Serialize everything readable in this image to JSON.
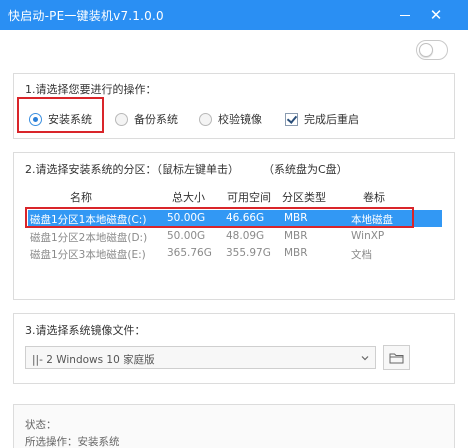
{
  "window": {
    "title": "快启动-PE一键装机v7.1.0.0",
    "minimize_icon": "minimize-icon",
    "close_icon": "close-icon",
    "accent": "#2a8ff3"
  },
  "toggle": {
    "state": "off"
  },
  "operation": {
    "label": "1.请选择您要进行的操作：",
    "options": [
      {
        "label": "安装系统",
        "selected": true
      },
      {
        "label": "备份系统",
        "selected": false
      },
      {
        "label": "校验镜像",
        "selected": false
      }
    ],
    "checkbox": {
      "label": "完成后重启",
      "checked": true
    }
  },
  "partition": {
    "label": "2.请选择安装系统的分区：（鼠标左键单击）",
    "hint": "（系统盘为C盘）",
    "columns": [
      "名称",
      "总大小",
      "可用空间",
      "分区类型",
      "卷标"
    ],
    "rows": [
      {
        "name": "磁盘1分区1本地磁盘(C:)",
        "total": "50.00G",
        "free": "46.66G",
        "type": "MBR",
        "label": "本地磁盘",
        "selected": true
      },
      {
        "name": "磁盘1分区2本地磁盘(D:)",
        "total": "50.00G",
        "free": "48.09G",
        "type": "MBR",
        "label": "WinXP",
        "selected": false
      },
      {
        "name": "磁盘1分区3本地磁盘(E:)",
        "total": "365.76G",
        "free": "355.97G",
        "type": "MBR",
        "label": "文档",
        "selected": false
      }
    ],
    "selection_color": "#3298f4"
  },
  "image": {
    "label": "3.请选择系统镜像文件：",
    "value": "||- 2 Windows  10 家庭版",
    "dropdown_icon": "chevron-down-icon",
    "folder_icon": "folder-icon"
  },
  "status": {
    "status_label": "状态：",
    "operation_text": "所选操作：安装系统"
  },
  "highlight_color": "#d9252a"
}
